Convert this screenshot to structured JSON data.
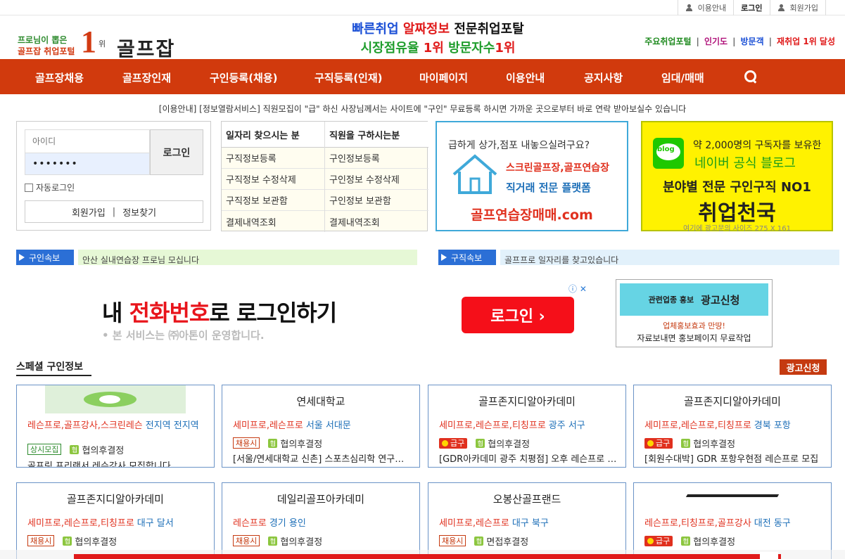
{
  "util": {
    "guide": "이용안내",
    "login": "로그인",
    "join": "회원가입"
  },
  "header": {
    "tag_line1": "프로님이 뽑은",
    "tag_line2": "골프잡 취업포털",
    "rank_num": "1",
    "rank_unit": "위",
    "site_name": "골프잡",
    "headline": {
      "p1": "빠른취업",
      "p2": "알짜정보",
      "p3": "전문취업포탈",
      "p4": "시장점유율",
      "p5": "1위",
      "p6": "방문자수",
      "p7": "1위"
    },
    "right": {
      "a": "주요취업포털",
      "b": "인기도",
      "c": "방문객",
      "d": "재취업 1위 달성",
      "sep": "|"
    }
  },
  "nav": {
    "items": [
      "골프장채용",
      "골프장인재",
      "구인등록(채용)",
      "구직등록(인재)",
      "마이페이지",
      "이용안내",
      "공지사항",
      "임대/매매"
    ]
  },
  "notice": "[이용안내] [정보열람서비스] 직원모집이 \"급\" 하신 사장님께서는 사이트에 \"구인\" 무료등록 하시면 가까운 곳으로부터 바로 연락 받아보실수 있습니다",
  "login_box": {
    "id_placeholder": "아이디",
    "pw_value": "•••••••",
    "login_button": "로그인",
    "auto_login": "자동로그인",
    "join": "회원가입",
    "find": "정보찾기",
    "bar": "|"
  },
  "job_table": {
    "seek_header": "일자리 찾으시는 분",
    "hire_header": "직원을 구하시는분",
    "seek": [
      "구직정보등록",
      "구직정보 수정삭제",
      "구직정보 보관함",
      "결제내역조회"
    ],
    "hire": [
      "구인정보등록",
      "구인정보 수정삭제",
      "구인정보 보관함",
      "결제내역조회"
    ]
  },
  "banner_house": {
    "q": "급하게 상가,점포 내놓으실려구요?",
    "l1": "스크린골프장,골프연습장",
    "l2": "직거래 전문 플랫폼",
    "url": "골프연습장매매.com"
  },
  "banner_blog": {
    "icon": "blog",
    "t1": "약 2,000명의 구독자를 보유한",
    "t2": "네이버 공식 블로그",
    "t3": "분야별 전문 구인구직 NO1",
    "t4": "취업천국",
    "t5": "여기에 광고문의 사이즈 275 X 161"
  },
  "tickers": {
    "hire_label": "구인속보",
    "hire_msg": "안산 실내연습장 프로님 모십니다",
    "seek_label": "구직속보",
    "seek_msg": "골프프로 일자리를 찾고있습니다"
  },
  "ad_main": {
    "h1": "내 ",
    "h2": "전화번호",
    "h3": "로 로그인하기",
    "sub": "• 본 서비스는 ㈜아톤이 운영합니다.",
    "button": "로그인 ›",
    "adchoice": "ⓘ ✕"
  },
  "ad_side": {
    "a": "관련업종 홍보",
    "b": "광고신청",
    "l1": "업체홍보효과 만땅!",
    "l2": "자료보내면 홍보페이지 무료작업"
  },
  "special": {
    "title": "스페셜 구인정보",
    "apply": "광고신청",
    "salary_icon": "협",
    "cards": [
      {
        "title": "",
        "job": "레슨프로,골프강사,스크린레슨",
        "loc": "전지역 전지역",
        "badge": "상시모집",
        "badge_type": "always",
        "salary": "협의후결정",
        "desc": "골프링 프리랜서 레슨강사 모집합니다"
      },
      {
        "title": "연세대학교",
        "job": "세미프로,레슨프로",
        "loc": "서울 서대문",
        "badge": "채용시",
        "badge_type": "hire",
        "salary": "협의후결정",
        "desc": "[서울/연세대학교 신촌] 스포츠심리학 연구원 모집"
      },
      {
        "title": "골프존지디알아카데미",
        "job": "세미프로,레슨프로,티칭프로",
        "loc": "광주 서구",
        "badge": "급구",
        "badge_type": "urgent",
        "salary": "협의후결정",
        "desc": "[GDR아카데미 광주 치평점] 오후 레슨프로 모집"
      },
      {
        "title": "골프존지디알아카데미",
        "job": "세미프로,레슨프로,티칭프로",
        "loc": "경북 포항",
        "badge": "급구",
        "badge_type": "urgent",
        "salary": "협의후결정",
        "desc": "[회원수대박] GDR 포항우현점 레슨프로 모집"
      },
      {
        "title": "골프존지디알아카데미",
        "job": "세미프로,레슨프로,티칭프로",
        "loc": "대구 달서",
        "badge": "채용시",
        "badge_type": "hire",
        "salary": "협의후결정",
        "desc": ""
      },
      {
        "title": "데일리골프아카데미",
        "job": "레슨프로",
        "loc": "경기 용인",
        "badge": "채용시",
        "badge_type": "hire",
        "salary": "협의후결정",
        "desc": ""
      },
      {
        "title": "오봉산골프랜드",
        "job": "세미프로,레슨프로",
        "loc": "대구 북구",
        "badge": "채용시",
        "badge_type": "hire",
        "salary": "면접후결정",
        "desc": ""
      },
      {
        "title": "",
        "job": "레슨프로,티칭프로,골프강사",
        "loc": "대전 동구",
        "badge": "급구",
        "badge_type": "urgent",
        "salary": "협의후결정",
        "desc": ""
      }
    ]
  },
  "colors": {
    "nav_bg": "#d13a0d",
    "accent_blue": "#2b6fd6",
    "accent_red": "#e0301e"
  }
}
